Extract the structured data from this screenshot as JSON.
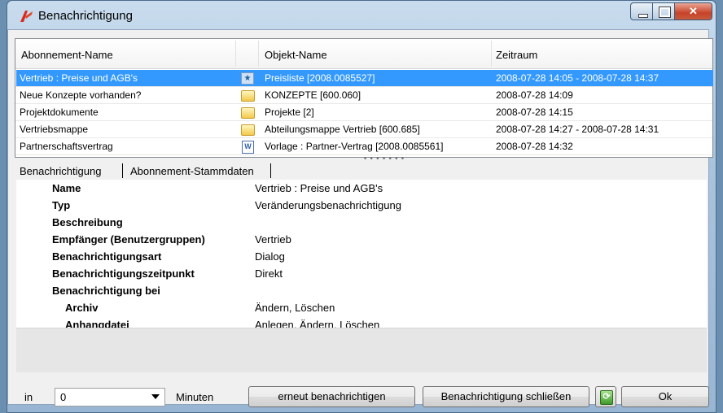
{
  "window": {
    "title": "Benachrichtigung"
  },
  "grid": {
    "columns": [
      "Abonnement-Name",
      "Objekt-Name",
      "Zeitraum"
    ],
    "rows": [
      {
        "name": "Vertrieb : Preise und AGB's",
        "icon": "star-document-icon",
        "object": "Preisliste [2008.0085527]",
        "period": "2008-07-28 14:05 - 2008-07-28 14:37",
        "selected": true
      },
      {
        "name": "Neue Konzepte vorhanden?",
        "icon": "folder-icon",
        "object": "KONZEPTE [600.060]",
        "period": "2008-07-28 14:09",
        "selected": false
      },
      {
        "name": "Projektdokumente",
        "icon": "folder-icon",
        "object": "Projekte [2]",
        "period": "2008-07-28 14:15",
        "selected": false
      },
      {
        "name": "Vertriebsmappe",
        "icon": "folder-icon",
        "object": "Abteilungsmappe Vertrieb [600.685]",
        "period": "2008-07-28 14:27 - 2008-07-28 14:31",
        "selected": false
      },
      {
        "name": "Partnerschaftsvertrag",
        "icon": "word-document-icon",
        "object": "Vorlage : Partner-Vertrag [2008.0085561]",
        "period": "2008-07-28 14:32",
        "selected": false
      }
    ]
  },
  "tabs": [
    {
      "label": "Benachrichtigung",
      "active": true
    },
    {
      "label": "Abonnement-Stammdaten",
      "active": false
    }
  ],
  "details": [
    {
      "label": "Name",
      "value": "Vertrieb : Preise und AGB's"
    },
    {
      "label": "Typ",
      "value": "Veränderungsbenachrichtigung"
    },
    {
      "label": "Beschreibung",
      "value": ""
    },
    {
      "label": "Empfänger (Benutzergruppen)",
      "value": "Vertrieb"
    },
    {
      "label": "Benachrichtigungsart",
      "value": "Dialog"
    },
    {
      "label": "Benachrichtigungszeitpunkt",
      "value": "Direkt"
    },
    {
      "label": "Benachrichtigung bei",
      "value": ""
    },
    {
      "label": "Archiv",
      "value": "Ändern, Löschen"
    },
    {
      "label": "Anhangdatei",
      "value": "Anlegen, Ändern, Löschen"
    }
  ],
  "footer": {
    "in_label": "in",
    "minutes_value": "0",
    "minutes_label": "Minuten",
    "renotify_button": "erneut benachrichtigen",
    "close_notification_button": "Benachrichtigung schließen",
    "ok_button": "Ok"
  },
  "colors": {
    "selection": "#3399ff",
    "window_frame": "#a9c3dc",
    "close_button": "#c7432a"
  }
}
